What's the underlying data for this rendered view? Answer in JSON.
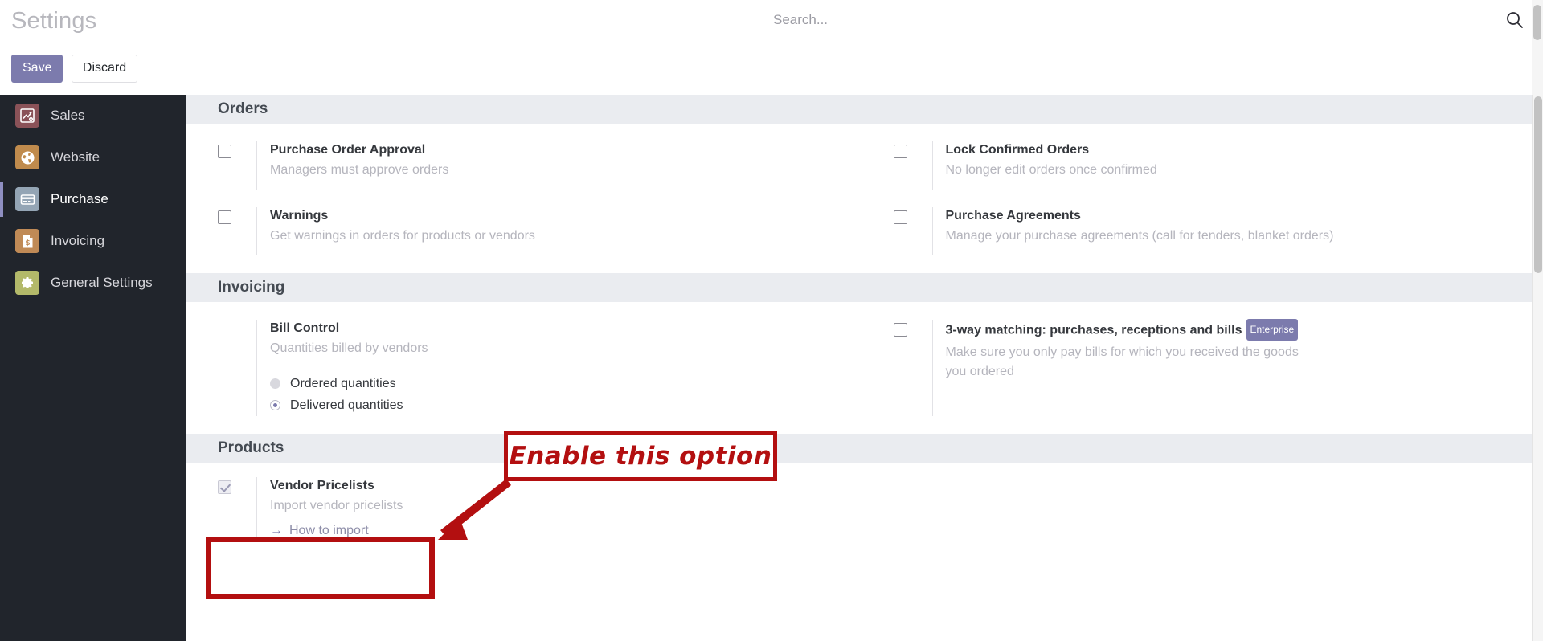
{
  "app": {
    "page_title": "Settings",
    "colors": {
      "brand_purple": "#7c7bad",
      "sidebar_bg": "#21252c",
      "section_header_bg": "#eaecf0",
      "annotation_red": "#b30f10"
    }
  },
  "toolbar": {
    "save_label": "Save",
    "discard_label": "Discard"
  },
  "search": {
    "value": "",
    "placeholder": "Search...",
    "icon": "search-icon"
  },
  "sidebar": {
    "items": [
      {
        "label": "Sales",
        "icon": "sales-chart-icon",
        "active": false,
        "icon_bg": "#8a5258"
      },
      {
        "label": "Website",
        "icon": "globe-icon",
        "active": false,
        "icon_bg": "#c08b4d"
      },
      {
        "label": "Purchase",
        "icon": "credit-card-icon",
        "active": true,
        "icon_bg": "#94a5b5"
      },
      {
        "label": "Invoicing",
        "icon": "invoice-dollar-icon",
        "active": false,
        "icon_bg": "#c08a56"
      },
      {
        "label": "General Settings",
        "icon": "gear-icon",
        "active": false,
        "icon_bg": "#b3b96a"
      }
    ]
  },
  "sections": [
    {
      "id": "orders",
      "title": "Orders",
      "options": [
        {
          "name": "purchase-order-approval",
          "title": "Purchase Order Approval",
          "desc": "Managers must approve orders",
          "type": "checkbox",
          "checked": false,
          "badge": null
        },
        {
          "name": "lock-confirmed-orders",
          "title": "Lock Confirmed Orders",
          "desc": "No longer edit orders once confirmed",
          "type": "checkbox",
          "checked": false,
          "badge": null
        },
        {
          "name": "warnings",
          "title": "Warnings",
          "desc": "Get warnings in orders for products or vendors",
          "type": "checkbox",
          "checked": false,
          "badge": null
        },
        {
          "name": "purchase-agreements",
          "title": "Purchase Agreements",
          "desc": "Manage your purchase agreements (call for tenders, blanket orders)",
          "type": "checkbox",
          "checked": false,
          "badge": null
        }
      ]
    },
    {
      "id": "invoicing",
      "title": "Invoicing",
      "options": [
        {
          "name": "bill-control",
          "title": "Bill Control",
          "desc": "Quantities billed by vendors",
          "type": "radio-group",
          "checked": null,
          "badge": null,
          "radios": [
            {
              "label": "Ordered quantities",
              "selected": false
            },
            {
              "label": "Delivered quantities",
              "selected": true
            }
          ]
        },
        {
          "name": "three-way-matching",
          "title": "3-way matching: purchases, receptions and bills",
          "desc": "Make sure you only pay bills for which you received the goods you ordered",
          "type": "checkbox",
          "checked": false,
          "badge": "Enterprise"
        }
      ]
    },
    {
      "id": "products",
      "title": "Products",
      "options": [
        {
          "name": "vendor-pricelists",
          "title": "Vendor Pricelists",
          "desc": "Import vendor pricelists",
          "type": "checkbox",
          "checked": true,
          "badge": null,
          "link": {
            "label": "How to import",
            "arrow": "→"
          }
        }
      ]
    }
  ],
  "annotations": {
    "callout_text": "Enable this option",
    "highlight_target": "vendor-pricelists"
  }
}
